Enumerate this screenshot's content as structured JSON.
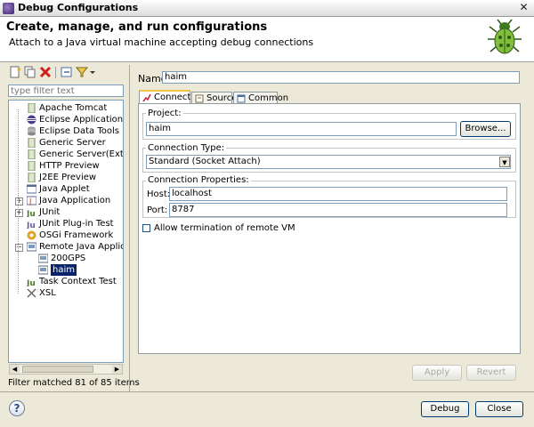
{
  "window": {
    "title": "Debug Configurations",
    "close": "✕"
  },
  "header": {
    "title": "Create, manage, and run configurations",
    "subtitle": "Attach to a Java virtual machine accepting debug connections"
  },
  "left": {
    "filter_placeholder": "type filter text",
    "toolbar_icons": [
      "new-configuration-icon",
      "duplicate-icon",
      "delete-icon",
      "collapse-all-icon",
      "filter-icon",
      "dropdown-icon"
    ],
    "tree": [
      {
        "label": "Apache Tomcat",
        "icon": "tomcat-icon"
      },
      {
        "label": "Eclipse Application",
        "icon": "eclipse-icon"
      },
      {
        "label": "Eclipse Data Tools",
        "icon": "database-icon"
      },
      {
        "label": "Generic Server",
        "icon": "server-icon"
      },
      {
        "label": "Generic Server(External La",
        "icon": "server-icon"
      },
      {
        "label": "HTTP Preview",
        "icon": "server-icon"
      },
      {
        "label": "J2EE Preview",
        "icon": "server-icon"
      },
      {
        "label": "Java Applet",
        "icon": "applet-icon"
      },
      {
        "label": "Java Application",
        "icon": "java-app-icon"
      },
      {
        "label": "JUnit",
        "icon": "junit-icon"
      },
      {
        "label": "JUnit Plug-in Test",
        "icon": "junit-plugin-icon"
      },
      {
        "label": "OSGi Framework",
        "icon": "osgi-icon"
      },
      {
        "label": "Remote Java Application",
        "icon": "remote-java-icon"
      },
      {
        "label": "200GPS",
        "icon": "debug-config-icon"
      },
      {
        "label": "haim",
        "icon": "debug-config-icon"
      },
      {
        "label": "Task Context Test",
        "icon": "task-icon"
      },
      {
        "label": "XSL",
        "icon": "xsl-icon"
      }
    ],
    "filter_status": "Filter matched 81 of 85 items"
  },
  "config": {
    "name_label": "Name:",
    "name_value": "haim",
    "tabs": [
      "Connect",
      "Source",
      "Common"
    ],
    "project_group": "Project:",
    "project_value": "haim",
    "browse_label": "Browse...",
    "conn_type_group": "Connection Type:",
    "conn_type_value": "Standard (Socket Attach)",
    "conn_props_group": "Connection Properties:",
    "host_label": "Host:",
    "host_value": "localhost",
    "port_label": "Port:",
    "port_value": "8787",
    "allow_termination_label": "Allow termination of remote VM",
    "allow_termination_checked": false
  },
  "buttons": {
    "apply": "Apply",
    "revert": "Revert",
    "debug": "Debug",
    "close": "Close",
    "help": "?"
  },
  "colors": {
    "selection": "#0a246a",
    "dialog_bg": "#ece9d8",
    "tab_highlight": "#f6c24a"
  }
}
